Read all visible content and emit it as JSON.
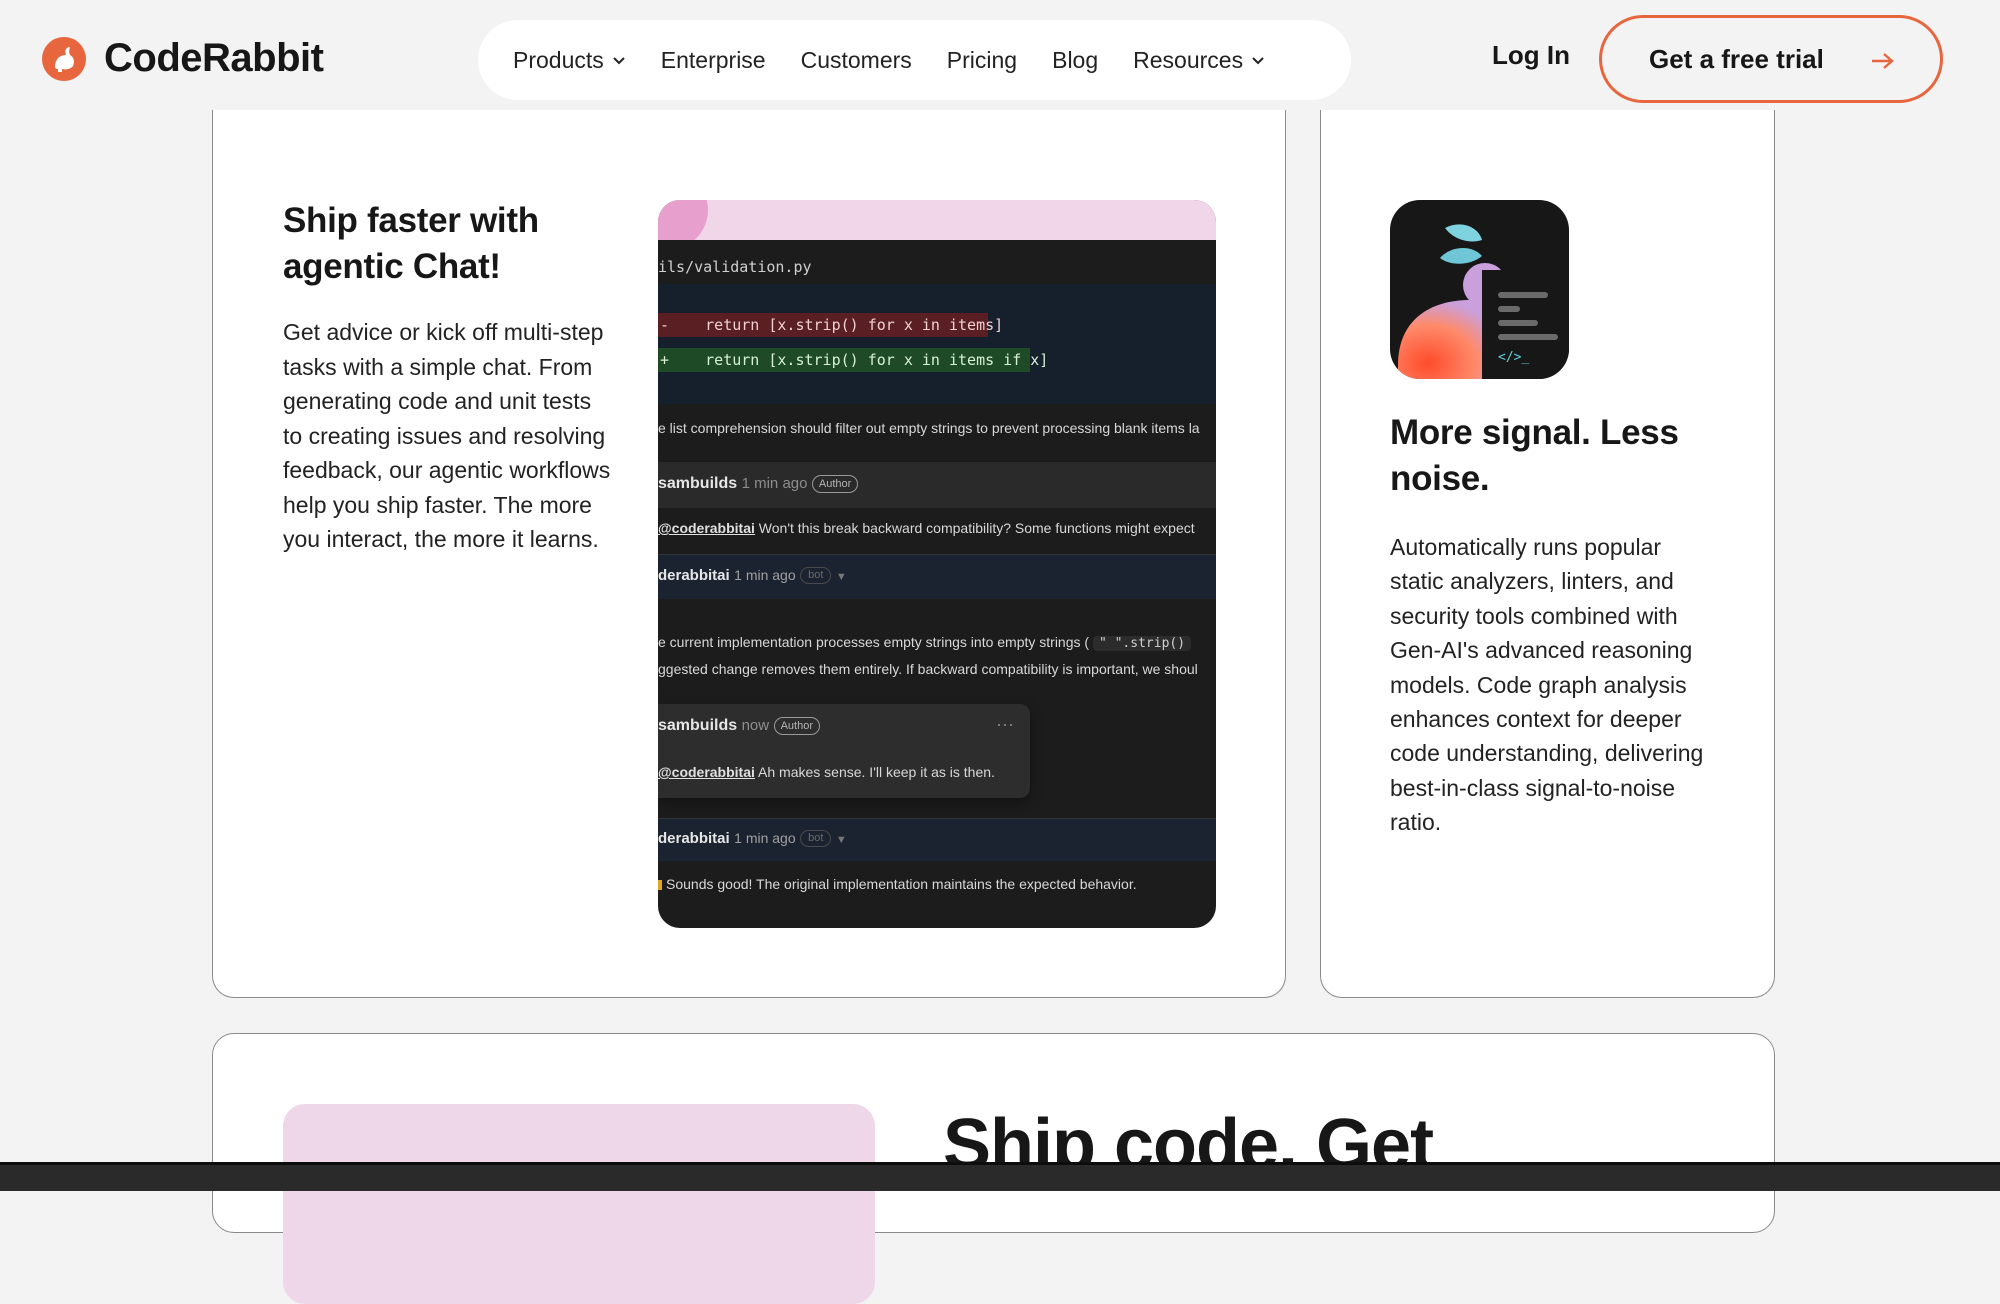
{
  "brand": {
    "name": "CodeRabbit",
    "accent": "#e8663d"
  },
  "nav": {
    "items": [
      {
        "label": "Products",
        "dropdown": true
      },
      {
        "label": "Enterprise",
        "dropdown": false
      },
      {
        "label": "Customers",
        "dropdown": false
      },
      {
        "label": "Pricing",
        "dropdown": false
      },
      {
        "label": "Blog",
        "dropdown": false
      },
      {
        "label": "Resources",
        "dropdown": true
      }
    ],
    "login": "Log In",
    "cta": "Get a free trial"
  },
  "chat_card": {
    "title": "Ship faster with agentic Chat!",
    "body": "Get advice or kick off multi-step tasks with a simple chat. From generating code and unit tests to creating issues and resolving feedback, our agentic workflows help you ship faster. The more you interact, the more it learns.",
    "mockup": {
      "file": "ils/validation.py",
      "diff_removed": "-    return [x.strip() for x in items]",
      "diff_added": "+    return [x.strip() for x in items if x]",
      "suggestion": "e list comprehension should filter out empty strings to prevent processing blank items la",
      "comments": [
        {
          "user": "sambuilds",
          "time": "1 min ago",
          "badge": "Author",
          "mention": "@coderabbitai",
          "text": "Won't this break backward compatibility? Some functions might expect"
        },
        {
          "user": "derabbitai",
          "time": "1 min ago",
          "badge": "bot",
          "line1_a": "e current implementation processes empty strings into empty strings (",
          "chip": "\"   \".strip()",
          "line2": "ggested change removes them entirely. If backward compatibility is important, we shoul"
        },
        {
          "user": "sambuilds",
          "time": "now",
          "badge": "Author",
          "mention": "@coderabbitai",
          "text": "Ah makes sense. I'll keep it as is then.",
          "more": "···"
        },
        {
          "user": "derabbitai",
          "time": "1 min ago",
          "badge": "bot",
          "text": "Sounds good! The original implementation maintains the expected behavior."
        }
      ]
    }
  },
  "signal_card": {
    "title": "More signal. Less noise.",
    "body": "Automatically runs popular static analyzers, linters, and security tools combined with Gen-AI's advanced reasoning models. Code graph analysis enhances context for deeper code understanding, delivering best-in-class signal-to-noise ratio.",
    "icon_code": "</>_"
  },
  "bottom_card": {
    "title": "Ship code. Get"
  }
}
